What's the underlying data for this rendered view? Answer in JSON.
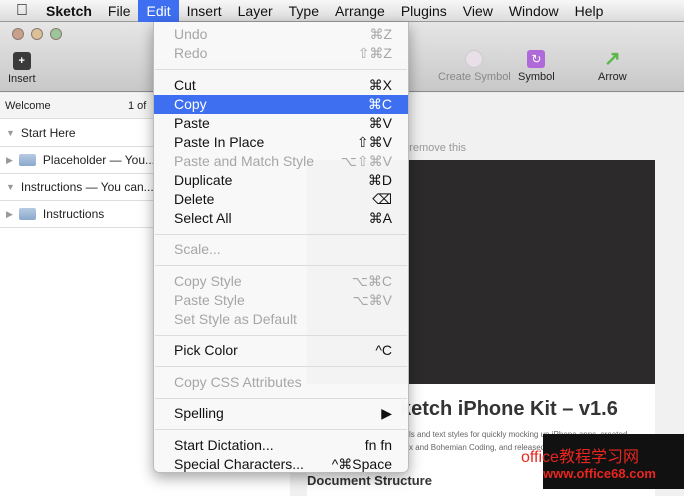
{
  "menubar": {
    "items": [
      "Sketch",
      "File",
      "Edit",
      "Insert",
      "Layer",
      "Type",
      "Arrange",
      "Plugins",
      "View",
      "Window",
      "Help"
    ],
    "active": "Edit"
  },
  "toolbar": {
    "insert": "Insert",
    "create_symbol": "Create Symbol",
    "symbol": "Symbol",
    "arrow": "Arrow"
  },
  "sidebar": {
    "header": "Welcome",
    "page_count": "1 of",
    "rows": [
      {
        "label": "Start Here",
        "type": "group-open"
      },
      {
        "label": "Placeholder — You...",
        "type": "folder"
      },
      {
        "label": "Instructions — You can...",
        "type": "group-open"
      },
      {
        "label": "Instructions",
        "type": "folder"
      }
    ]
  },
  "canvas": {
    "hint": "n remove this",
    "title": "ketch iPhone Kit – v1.6",
    "desc1": "ls and text styles for quickly mocking up iPhone apps, created",
    "desc2": "x and Bohemian Coding, and released",
    "section": "Document Structure"
  },
  "edit_menu": [
    {
      "label": "Undo",
      "shortcut": "⌘Z",
      "disabled": true
    },
    {
      "label": "Redo",
      "shortcut": "⇧⌘Z",
      "disabled": true
    },
    {
      "sep": true
    },
    {
      "label": "Cut",
      "shortcut": "⌘X"
    },
    {
      "label": "Copy",
      "shortcut": "⌘C",
      "highlighted": true
    },
    {
      "label": "Paste",
      "shortcut": "⌘V"
    },
    {
      "label": "Paste In Place",
      "shortcut": "⇧⌘V"
    },
    {
      "label": "Paste and Match Style",
      "shortcut": "⌥⇧⌘V",
      "disabled": true
    },
    {
      "label": "Duplicate",
      "shortcut": "⌘D"
    },
    {
      "label": "Delete",
      "shortcut": "⌫"
    },
    {
      "label": "Select All",
      "shortcut": "⌘A"
    },
    {
      "sep": true
    },
    {
      "label": "Scale...",
      "shortcut": "",
      "disabled": true
    },
    {
      "sep": true
    },
    {
      "label": "Copy Style",
      "shortcut": "⌥⌘C",
      "disabled": true
    },
    {
      "label": "Paste Style",
      "shortcut": "⌥⌘V",
      "disabled": true
    },
    {
      "label": "Set Style as Default",
      "shortcut": "",
      "disabled": true
    },
    {
      "sep": true
    },
    {
      "label": "Pick Color",
      "shortcut": "^C"
    },
    {
      "sep": true
    },
    {
      "label": "Copy CSS Attributes",
      "shortcut": "",
      "disabled": true
    },
    {
      "sep": true
    },
    {
      "label": "Spelling",
      "shortcut": "▶"
    },
    {
      "sep": true
    },
    {
      "label": "Start Dictation...",
      "shortcut": "fn fn"
    },
    {
      "label": "Special Characters...",
      "shortcut": "^⌘Space"
    }
  ],
  "watermark": {
    "line1": "office教程学习网",
    "line2": "www.office68.com"
  },
  "colors": {
    "highlight": "#3d6ff0",
    "artboard": "#2d2a2b"
  }
}
